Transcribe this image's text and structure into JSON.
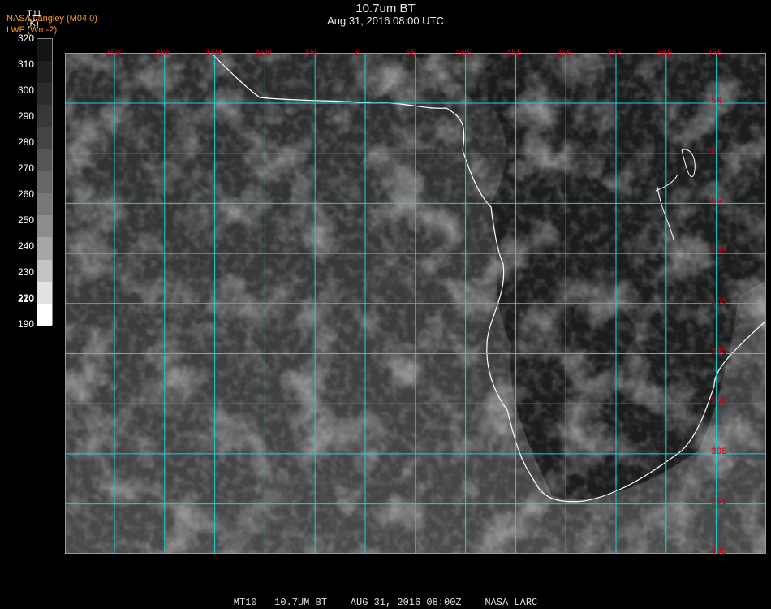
{
  "header": {
    "title": "10.7um BT",
    "subtitle": "Aug 31, 2016 08:00 UTC",
    "credit_line1": "NASA Langley (M04.0)",
    "credit_line2": "LWF (Wm-2)"
  },
  "legend": {
    "variable": "T11",
    "unit": "(K)",
    "ticks": [
      "320",
      "310",
      "300",
      "290",
      "280",
      "270",
      "260",
      "250",
      "240",
      "230",
      "220",
      "210",
      "190"
    ],
    "colors": [
      "#141414",
      "#202020",
      "#2c2c2c",
      "#383838",
      "#444444",
      "#555555",
      "#666666",
      "#777777",
      "#8c8c8c",
      "#a6a6a6",
      "#c4c4c4",
      "#e2e2e2",
      "#ffffff"
    ]
  },
  "map": {
    "longitude_labels": [
      "25W",
      "20W",
      "15W",
      "10W",
      "5W",
      "0",
      "5E",
      "10E",
      "15E",
      "20E",
      "25E",
      "30E",
      "35E"
    ],
    "latitude_labels": [
      "5N",
      "0",
      "5S",
      "10S",
      "15S",
      "20S",
      "25S",
      "30S",
      "35S",
      "40S"
    ],
    "grid_color": "#19d3d3",
    "coast_color": "#ffffff",
    "label_color": "#c8001a"
  },
  "footer": {
    "text": "MT10   10.7UM BT    AUG 31, 2016 08:00Z    NASA LARC"
  }
}
